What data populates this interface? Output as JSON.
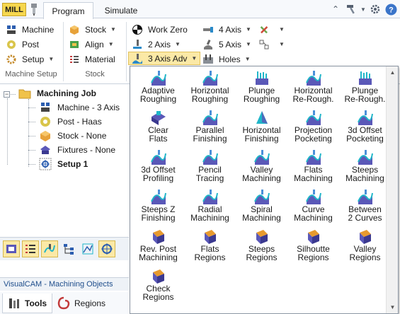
{
  "app": {
    "mill_badge": "MILL",
    "tabs": [
      "Program",
      "Simulate"
    ]
  },
  "ribbon": {
    "machine_setup": {
      "items": [
        "Machine",
        "Post",
        "Setup"
      ],
      "label": "Machine Setup"
    },
    "stock": {
      "items": [
        "Stock",
        "Align",
        "Material"
      ],
      "label": "Stock"
    },
    "ops": {
      "work_zero": "Work Zero",
      "two_axis": "2 Axis",
      "three_axis_adv": "3 Axis Adv",
      "four_axis": "4 Axis",
      "five_axis": "5 Axis",
      "holes": "Holes"
    }
  },
  "tree": {
    "root": "Machining Job",
    "children": [
      "Machine - 3 Axis",
      "Post - Haas",
      "Stock - None",
      "Fixtures - None",
      "Setup 1"
    ]
  },
  "panel": {
    "title": "VisualCAM - Machining Objects",
    "tabs": [
      "Tools",
      "Regions"
    ]
  },
  "gallery": {
    "items": [
      "Adaptive\nRoughing",
      "Horizontal\nRoughing",
      "Plunge\nRoughing",
      "Horizontal\nRe-Rough.",
      "Plunge\nRe-Rough.",
      "Clear\nFlats",
      "Parallel\nFinishing",
      "Horizontal\nFinishing",
      "Projection\nPocketing",
      "3d Offset\nPocketing",
      "3d Offset\nProfiling",
      "Pencil\nTracing",
      "Valley\nMachining",
      "Flats\nMachining",
      "Steeps\nMachining",
      "Steeps Z\nFinishing",
      "Radial\nMachining",
      "Spiral\nMachining",
      "Curve\nMachining",
      "Between\n2 Curves",
      "Rev. Post\nMachining",
      "Flats\nRegions",
      "Steeps\nRegions",
      "Silhoutte\nRegions",
      "Valley\nRegions",
      "Check\nRegions"
    ]
  },
  "colors": {
    "accent_yellow": "#f6d74e",
    "selected_fill": "#fbe9a6",
    "icon_purple": "#5a58b8",
    "icon_teal": "#1fb6c9",
    "icon_orange": "#e79a2e"
  }
}
